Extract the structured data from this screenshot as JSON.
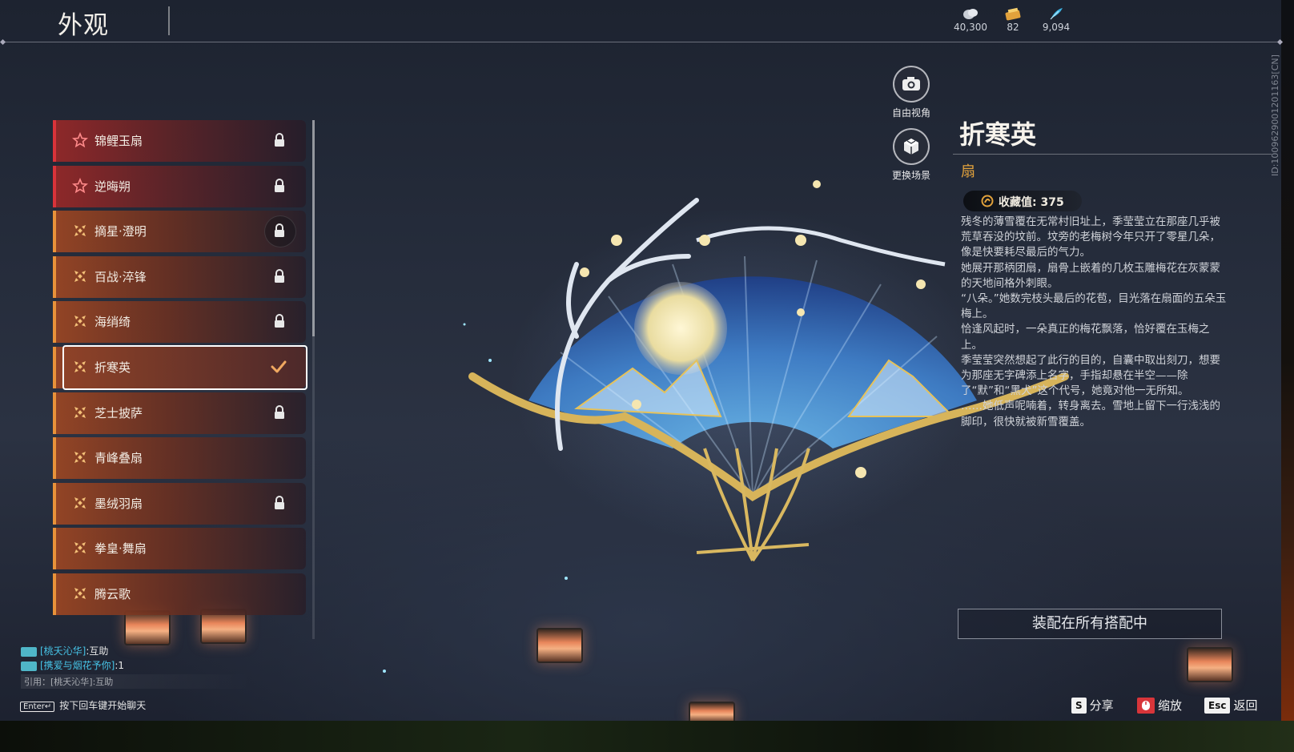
{
  "header": {
    "title": "外观",
    "currencies": [
      {
        "icon": "silver-coin-icon",
        "value": "40,300"
      },
      {
        "icon": "gold-ticket-icon",
        "value": "82"
      },
      {
        "icon": "feather-icon",
        "value": "9,094"
      }
    ]
  },
  "items": [
    {
      "name": "锦鲤玉扇",
      "rarity": "red",
      "icon": "star-icon",
      "locked": true
    },
    {
      "name": "逆晦朔",
      "rarity": "red",
      "icon": "star-icon",
      "locked": true
    },
    {
      "name": "摘星·澄明",
      "rarity": "orange",
      "icon": "cross-icon",
      "locked": true
    },
    {
      "name": "百战·淬锋",
      "rarity": "orange",
      "icon": "cross-icon",
      "locked": true
    },
    {
      "name": "海绡绮",
      "rarity": "orange",
      "icon": "cross-icon",
      "locked": true
    },
    {
      "name": "折寒英",
      "rarity": "orange",
      "icon": "cross-icon",
      "locked": false,
      "selected": true
    },
    {
      "name": "芝士披萨",
      "rarity": "orange",
      "icon": "cross-icon",
      "locked": true
    },
    {
      "name": "青峰叠扇",
      "rarity": "orange",
      "icon": "cross-icon",
      "locked": false
    },
    {
      "name": "墨绒羽扇",
      "rarity": "orange",
      "icon": "cross-icon",
      "locked": true
    },
    {
      "name": "拳皇·舞扇",
      "rarity": "orange",
      "icon": "cross-icon",
      "locked": false
    },
    {
      "name": "腾云歌",
      "rarity": "orange",
      "icon": "cross-icon",
      "locked": false
    }
  ],
  "camera": {
    "free_view": "自由视角",
    "change_scene": "更换场景"
  },
  "detail": {
    "name": "折寒英",
    "type": "扇",
    "collect_label": "收藏值: 375",
    "description": [
      "残冬的薄雪覆在无常村旧址上，季莹莹立在那座几乎被荒草吞没的坟前。坟旁的老梅树今年只开了零星几朵，像是快要耗尽最后的气力。",
      "她展开那柄团扇，扇骨上嵌着的几枚玉雕梅花在灰蒙蒙的天地间格外刺眼。",
      "“八朵。”她数完枝头最后的花苞，目光落在扇面的五朵玉梅上。",
      "恰逢风起时，一朵真正的梅花飘落，恰好覆在玉梅之上。",
      "季莹莹突然想起了此行的目的，自囊中取出刻刀，想要为那座无字碑添上名字，手指却悬在半空——除了“默”和“黑犬”这个代号，她竟对他一无所知。",
      "……她低声呢喃着，转身离去。雪地上留下一行浅浅的脚印，很快就被新雪覆盖。"
    ],
    "equip_button": "装配在所有搭配中",
    "side_id": "ID:1009629001201163[CN]"
  },
  "hotkeys": [
    {
      "key": "S",
      "label": "分享"
    },
    {
      "key": "🖱",
      "label": "缩放"
    },
    {
      "key": "Esc",
      "label": "返回"
    }
  ],
  "chat": {
    "lines": [
      {
        "who": "[桃夭沁华]",
        "text": ":互助"
      },
      {
        "who": "[携爱与烟花予你]",
        "text": ":1"
      }
    ],
    "quote": "引用：[桃夭沁华]:互助",
    "enter_key": "Enter↵",
    "hint": "按下回车键开始聊天"
  },
  "colors": {
    "accent_orange": "#e8923a",
    "accent_red": "#d9333a",
    "type_gold": "#e2a23c"
  }
}
